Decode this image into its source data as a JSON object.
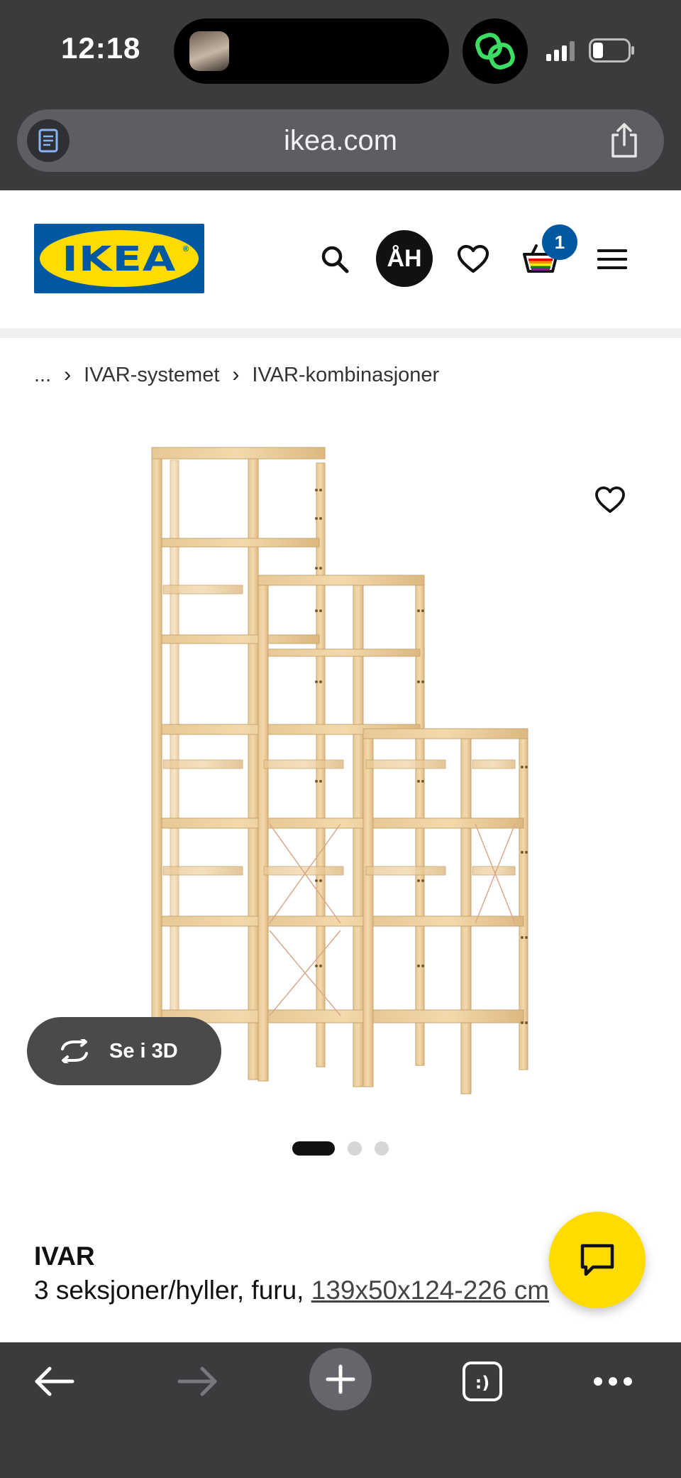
{
  "status_bar": {
    "time": "12:18"
  },
  "browser": {
    "url": "ikea.com"
  },
  "header": {
    "logo_text": "IKEA",
    "avatar_initials": "ÅH",
    "cart_count": "1"
  },
  "breadcrumb": {
    "ellipsis": "...",
    "items": [
      "IVAR-systemet",
      "IVAR-kombinasjoner"
    ]
  },
  "gallery": {
    "view_3d_label": "Se i 3D",
    "image_count": 3,
    "active_index": 0
  },
  "product": {
    "name": "IVAR",
    "description": "3 seksjoner/hyller, furu, ",
    "dimensions": "139x50x124-226 cm"
  },
  "colors": {
    "ikea_blue": "#0058a3",
    "ikea_yellow": "#ffdb00",
    "browser_chrome": "#3a3b3d"
  }
}
